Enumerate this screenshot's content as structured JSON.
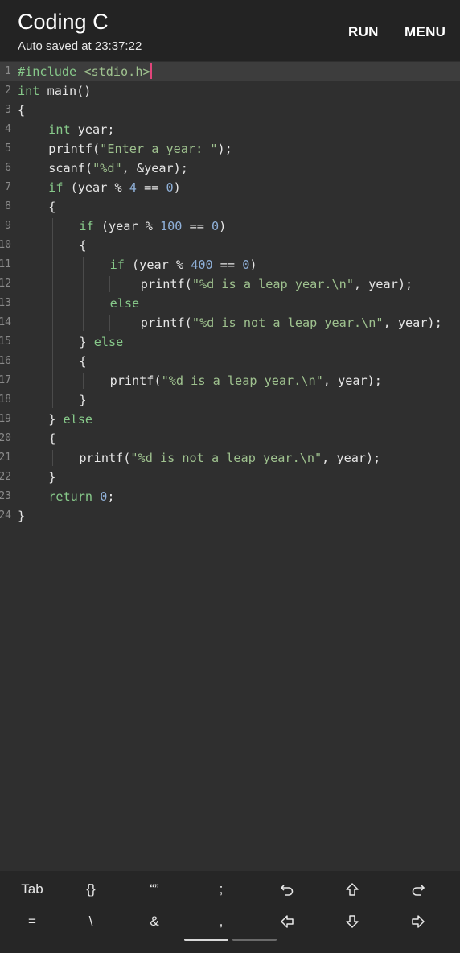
{
  "app": {
    "title": "Coding C",
    "autosave": "Auto saved at 23:37:22",
    "run_label": "RUN",
    "menu_label": "MENU"
  },
  "editor": {
    "lines": [
      {
        "n": "1",
        "indent": 0,
        "html": "<span class=\"kw\">#include</span> <span class=\"str\">&lt;stdio.h&gt;</span><span class=\"caret\"></span>"
      },
      {
        "n": "2",
        "indent": 0,
        "html": "<span class=\"kw\">int</span> main()"
      },
      {
        "n": "3",
        "indent": 0,
        "html": "{"
      },
      {
        "n": "4",
        "indent": 1,
        "html": "<span class=\"kw\">int</span> year;"
      },
      {
        "n": "5",
        "indent": 1,
        "html": "printf(<span class=\"str\">\"Enter a year: \"</span>);"
      },
      {
        "n": "6",
        "indent": 1,
        "html": "scanf(<span class=\"str\">\"%d\"</span>, &amp;year);"
      },
      {
        "n": "7",
        "indent": 1,
        "html": "<span class=\"kw\">if</span> (year % <span class=\"num\">4</span> == <span class=\"num\">0</span>)"
      },
      {
        "n": "8",
        "indent": 1,
        "html": "{"
      },
      {
        "n": "9",
        "indent": 2,
        "html": "<span class=\"kw\">if</span> (year % <span class=\"num\">100</span> == <span class=\"num\">0</span>)"
      },
      {
        "n": "10",
        "indent": 2,
        "html": "{"
      },
      {
        "n": "11",
        "indent": 3,
        "html": "<span class=\"kw\">if</span> (year % <span class=\"num\">400</span> == <span class=\"num\">0</span>)"
      },
      {
        "n": "12",
        "indent": 4,
        "html": "printf(<span class=\"str\">\"%d is a leap year.\\n\"</span>, year);"
      },
      {
        "n": "13",
        "indent": 3,
        "html": "<span class=\"kw\">else</span>"
      },
      {
        "n": "14",
        "indent": 4,
        "html": "printf(<span class=\"str\">\"%d is not a leap year.\\n\"</span>, year);"
      },
      {
        "n": "15",
        "indent": 2,
        "html": "} <span class=\"kw\">else</span>"
      },
      {
        "n": "16",
        "indent": 2,
        "html": "{"
      },
      {
        "n": "17",
        "indent": 3,
        "html": "printf(<span class=\"str\">\"%d is a leap year.\\n\"</span>, year);"
      },
      {
        "n": "18",
        "indent": 2,
        "html": "}"
      },
      {
        "n": "19",
        "indent": 1,
        "html": "} <span class=\"kw\">else</span>"
      },
      {
        "n": "20",
        "indent": 1,
        "html": "{"
      },
      {
        "n": "21",
        "indent": 2,
        "html": "printf(<span class=\"str\">\"%d is not a leap year.\\n\"</span>, year);"
      },
      {
        "n": "22",
        "indent": 1,
        "html": "}"
      },
      {
        "n": "23",
        "indent": 1,
        "html": "<span class=\"kw\">return</span> <span class=\"num\">0</span>;"
      },
      {
        "n": "24",
        "indent": 0,
        "html": "}"
      }
    ]
  },
  "keyboard": {
    "row1": [
      {
        "label": "Tab",
        "name": "tab-key"
      },
      {
        "label": "{}",
        "name": "braces-key"
      },
      {
        "label": "“”",
        "name": "quotes-key"
      },
      {
        "label": ";",
        "name": "semicolon-key"
      },
      {
        "label": "",
        "name": "undo-icon"
      },
      {
        "label": "",
        "name": "arrow-up-icon"
      },
      {
        "label": "",
        "name": "redo-icon"
      }
    ],
    "row2": [
      {
        "label": "=",
        "name": "equals-key"
      },
      {
        "label": "\\",
        "name": "backslash-key"
      },
      {
        "label": "&",
        "name": "ampersand-key"
      },
      {
        "label": ",",
        "name": "comma-key"
      },
      {
        "label": "",
        "name": "arrow-left-icon"
      },
      {
        "label": "",
        "name": "arrow-down-icon"
      },
      {
        "label": "",
        "name": "arrow-right-icon"
      }
    ]
  }
}
